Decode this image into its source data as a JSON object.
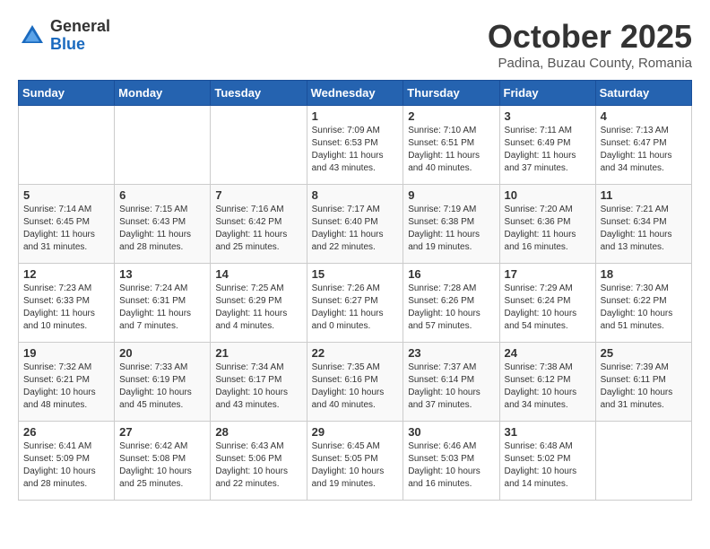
{
  "header": {
    "logo_general": "General",
    "logo_blue": "Blue",
    "month_title": "October 2025",
    "subtitle": "Padina, Buzau County, Romania"
  },
  "weekdays": [
    "Sunday",
    "Monday",
    "Tuesday",
    "Wednesday",
    "Thursday",
    "Friday",
    "Saturday"
  ],
  "weeks": [
    [
      {
        "day": "",
        "info": ""
      },
      {
        "day": "",
        "info": ""
      },
      {
        "day": "",
        "info": ""
      },
      {
        "day": "1",
        "info": "Sunrise: 7:09 AM\nSunset: 6:53 PM\nDaylight: 11 hours\nand 43 minutes."
      },
      {
        "day": "2",
        "info": "Sunrise: 7:10 AM\nSunset: 6:51 PM\nDaylight: 11 hours\nand 40 minutes."
      },
      {
        "day": "3",
        "info": "Sunrise: 7:11 AM\nSunset: 6:49 PM\nDaylight: 11 hours\nand 37 minutes."
      },
      {
        "day": "4",
        "info": "Sunrise: 7:13 AM\nSunset: 6:47 PM\nDaylight: 11 hours\nand 34 minutes."
      }
    ],
    [
      {
        "day": "5",
        "info": "Sunrise: 7:14 AM\nSunset: 6:45 PM\nDaylight: 11 hours\nand 31 minutes."
      },
      {
        "day": "6",
        "info": "Sunrise: 7:15 AM\nSunset: 6:43 PM\nDaylight: 11 hours\nand 28 minutes."
      },
      {
        "day": "7",
        "info": "Sunrise: 7:16 AM\nSunset: 6:42 PM\nDaylight: 11 hours\nand 25 minutes."
      },
      {
        "day": "8",
        "info": "Sunrise: 7:17 AM\nSunset: 6:40 PM\nDaylight: 11 hours\nand 22 minutes."
      },
      {
        "day": "9",
        "info": "Sunrise: 7:19 AM\nSunset: 6:38 PM\nDaylight: 11 hours\nand 19 minutes."
      },
      {
        "day": "10",
        "info": "Sunrise: 7:20 AM\nSunset: 6:36 PM\nDaylight: 11 hours\nand 16 minutes."
      },
      {
        "day": "11",
        "info": "Sunrise: 7:21 AM\nSunset: 6:34 PM\nDaylight: 11 hours\nand 13 minutes."
      }
    ],
    [
      {
        "day": "12",
        "info": "Sunrise: 7:23 AM\nSunset: 6:33 PM\nDaylight: 11 hours\nand 10 minutes."
      },
      {
        "day": "13",
        "info": "Sunrise: 7:24 AM\nSunset: 6:31 PM\nDaylight: 11 hours\nand 7 minutes."
      },
      {
        "day": "14",
        "info": "Sunrise: 7:25 AM\nSunset: 6:29 PM\nDaylight: 11 hours\nand 4 minutes."
      },
      {
        "day": "15",
        "info": "Sunrise: 7:26 AM\nSunset: 6:27 PM\nDaylight: 11 hours\nand 0 minutes."
      },
      {
        "day": "16",
        "info": "Sunrise: 7:28 AM\nSunset: 6:26 PM\nDaylight: 10 hours\nand 57 minutes."
      },
      {
        "day": "17",
        "info": "Sunrise: 7:29 AM\nSunset: 6:24 PM\nDaylight: 10 hours\nand 54 minutes."
      },
      {
        "day": "18",
        "info": "Sunrise: 7:30 AM\nSunset: 6:22 PM\nDaylight: 10 hours\nand 51 minutes."
      }
    ],
    [
      {
        "day": "19",
        "info": "Sunrise: 7:32 AM\nSunset: 6:21 PM\nDaylight: 10 hours\nand 48 minutes."
      },
      {
        "day": "20",
        "info": "Sunrise: 7:33 AM\nSunset: 6:19 PM\nDaylight: 10 hours\nand 45 minutes."
      },
      {
        "day": "21",
        "info": "Sunrise: 7:34 AM\nSunset: 6:17 PM\nDaylight: 10 hours\nand 43 minutes."
      },
      {
        "day": "22",
        "info": "Sunrise: 7:35 AM\nSunset: 6:16 PM\nDaylight: 10 hours\nand 40 minutes."
      },
      {
        "day": "23",
        "info": "Sunrise: 7:37 AM\nSunset: 6:14 PM\nDaylight: 10 hours\nand 37 minutes."
      },
      {
        "day": "24",
        "info": "Sunrise: 7:38 AM\nSunset: 6:12 PM\nDaylight: 10 hours\nand 34 minutes."
      },
      {
        "day": "25",
        "info": "Sunrise: 7:39 AM\nSunset: 6:11 PM\nDaylight: 10 hours\nand 31 minutes."
      }
    ],
    [
      {
        "day": "26",
        "info": "Sunrise: 6:41 AM\nSunset: 5:09 PM\nDaylight: 10 hours\nand 28 minutes."
      },
      {
        "day": "27",
        "info": "Sunrise: 6:42 AM\nSunset: 5:08 PM\nDaylight: 10 hours\nand 25 minutes."
      },
      {
        "day": "28",
        "info": "Sunrise: 6:43 AM\nSunset: 5:06 PM\nDaylight: 10 hours\nand 22 minutes."
      },
      {
        "day": "29",
        "info": "Sunrise: 6:45 AM\nSunset: 5:05 PM\nDaylight: 10 hours\nand 19 minutes."
      },
      {
        "day": "30",
        "info": "Sunrise: 6:46 AM\nSunset: 5:03 PM\nDaylight: 10 hours\nand 16 minutes."
      },
      {
        "day": "31",
        "info": "Sunrise: 6:48 AM\nSunset: 5:02 PM\nDaylight: 10 hours\nand 14 minutes."
      },
      {
        "day": "",
        "info": ""
      }
    ]
  ]
}
